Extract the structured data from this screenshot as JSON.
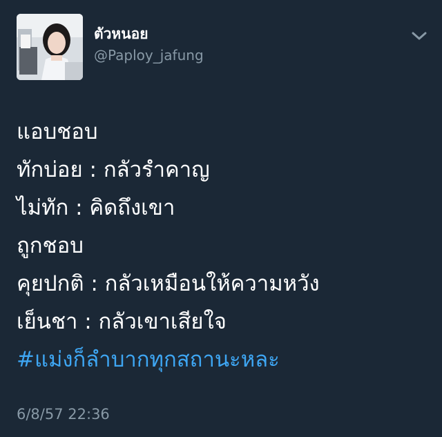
{
  "user": {
    "display_name": "ตัวหนอย",
    "handle": "@Paploy_jafung"
  },
  "tweet": {
    "lines": [
      "แอบชอบ",
      "ทักบ่อย : กลัวรำคาญ",
      "ไม่ทัก : คิดถึงเขา",
      "ถูกชอบ",
      "คุยปกติ : กลัวเหมือนให้ความหวัง",
      "เย็นชา : กลัวเขาเสียใจ"
    ],
    "hashtag": "#แม่งก็ลำบากทุกสถานะหละ",
    "timestamp": "6/8/57 22:36"
  },
  "icons": {
    "menu": "chevron-down-icon",
    "avatar": "profile-photo"
  },
  "colors": {
    "background": "#1b2836",
    "text": "#ffffff",
    "muted": "#8899a6",
    "link": "#3ea6f3"
  }
}
